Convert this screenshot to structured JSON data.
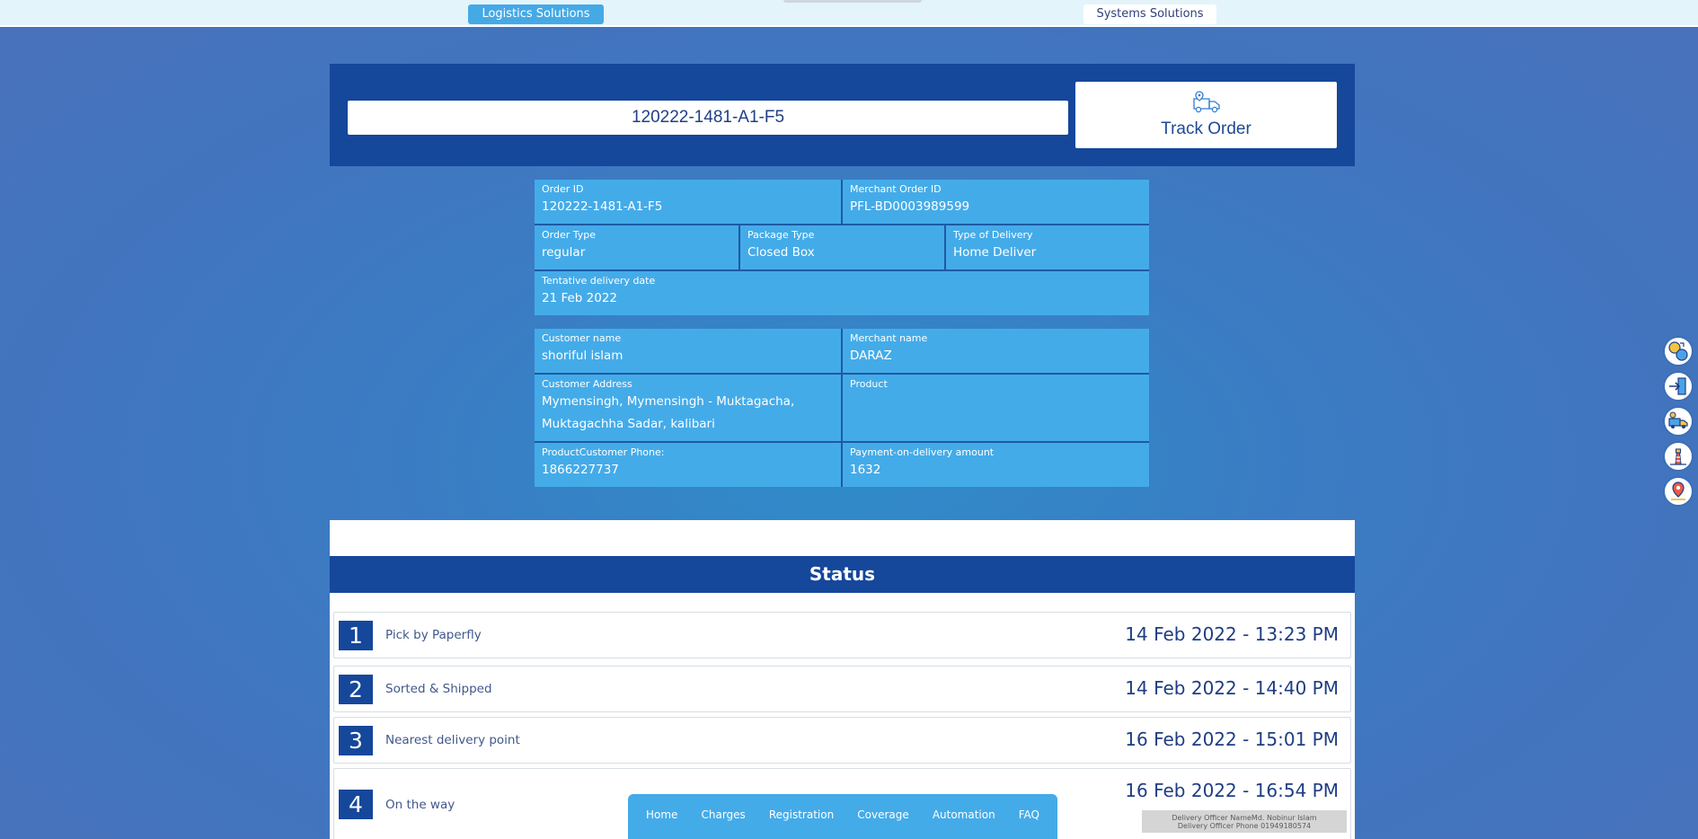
{
  "topbar": {
    "logistics_label": "Logistics Solutions",
    "systems_label": "Systems Solutions"
  },
  "search": {
    "value": "120222-1481-A1-F5",
    "track_label": "Track Order"
  },
  "order": {
    "order_id_label": "Order ID",
    "order_id": "120222-1481-A1-F5",
    "merchant_order_id_label": "Merchant Order ID",
    "merchant_order_id": "PFL-BD0003989599",
    "order_type_label": "Order Type",
    "order_type": "regular",
    "package_type_label": "Package Type",
    "package_type": "Closed Box",
    "delivery_type_label": "Type of Delivery",
    "delivery_type": "Home Deliver",
    "tentative_label": "Tentative delivery date",
    "tentative_date": "21 Feb 2022"
  },
  "customer": {
    "name_label": "Customer name",
    "name": "shoriful islam",
    "merchant_label": "Merchant name",
    "merchant": "DARAZ",
    "address_label": "Customer Address",
    "address_line1": "Mymensingh, Mymensingh - Muktagacha,",
    "address_line2": "Muktagachha Sadar, kalibari",
    "product_label": "Product",
    "product": "",
    "phone_label": "ProductCustomer Phone:",
    "phone": "1866227737",
    "pod_label": "Payment-on-delivery amount",
    "pod_amount": "1632"
  },
  "status": {
    "heading": "Status",
    "steps": [
      {
        "num": "1",
        "name": "Pick by Paperfly",
        "time": "14 Feb 2022 - 13:23 PM"
      },
      {
        "num": "2",
        "name": "Sorted & Shipped",
        "time": "14 Feb 2022 - 14:40 PM"
      },
      {
        "num": "3",
        "name": "Nearest delivery point",
        "time": "16 Feb 2022 - 15:01 PM"
      },
      {
        "num": "4",
        "name": "On the way",
        "time": "16 Feb 2022 - 16:54 PM"
      }
    ],
    "officer_name": "Delivery Officer NameMd. Nobinur Islam",
    "officer_phone": "Delivery Officer Phone 01949180574"
  },
  "nav": {
    "home": "Home",
    "charges": "Charges",
    "registration": "Registration",
    "coverage": "Coverage",
    "automation": "Automation",
    "faq": "FAQ"
  },
  "side_icons": [
    "currency-exchange-icon",
    "login-icon",
    "delivery-truck-icon",
    "lighthouse-icon",
    "location-pin-icon"
  ],
  "colors": {
    "primary_dark": "#15479b",
    "accent": "#44abe9",
    "background": "#4274be"
  }
}
